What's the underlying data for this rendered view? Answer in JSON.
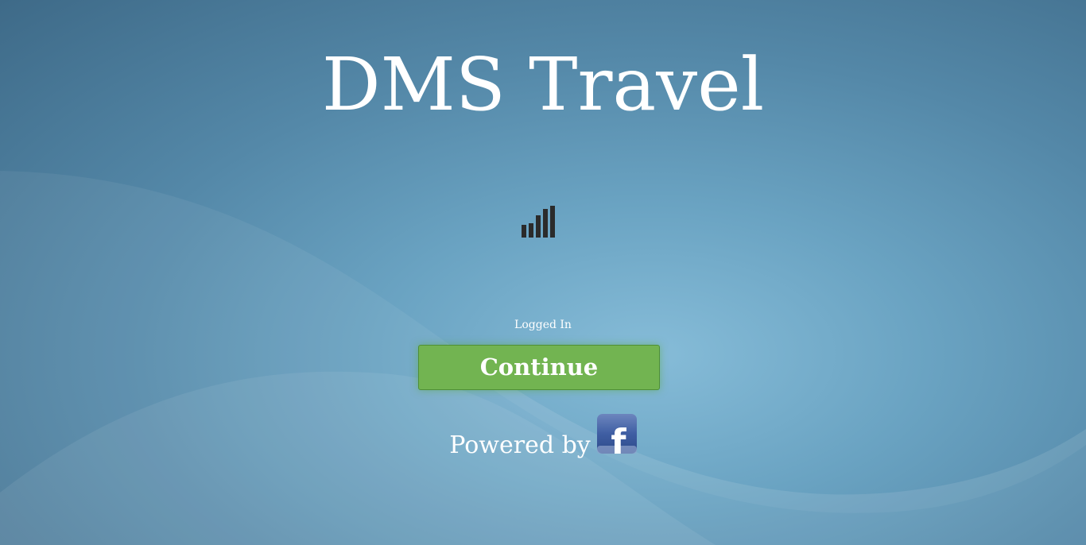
{
  "app": {
    "title": "DMS Travel"
  },
  "loader": {
    "icon": "signal-bars-icon"
  },
  "status": {
    "text": "Logged In"
  },
  "actions": {
    "continue_label": "Continue"
  },
  "footer": {
    "powered_by": "Powered by",
    "provider_icon": "facebook-icon",
    "provider_glyph": "f"
  },
  "colors": {
    "button_green": "#72b451",
    "background_blue": "#5f98b8",
    "facebook_blue": "#3b5998"
  }
}
